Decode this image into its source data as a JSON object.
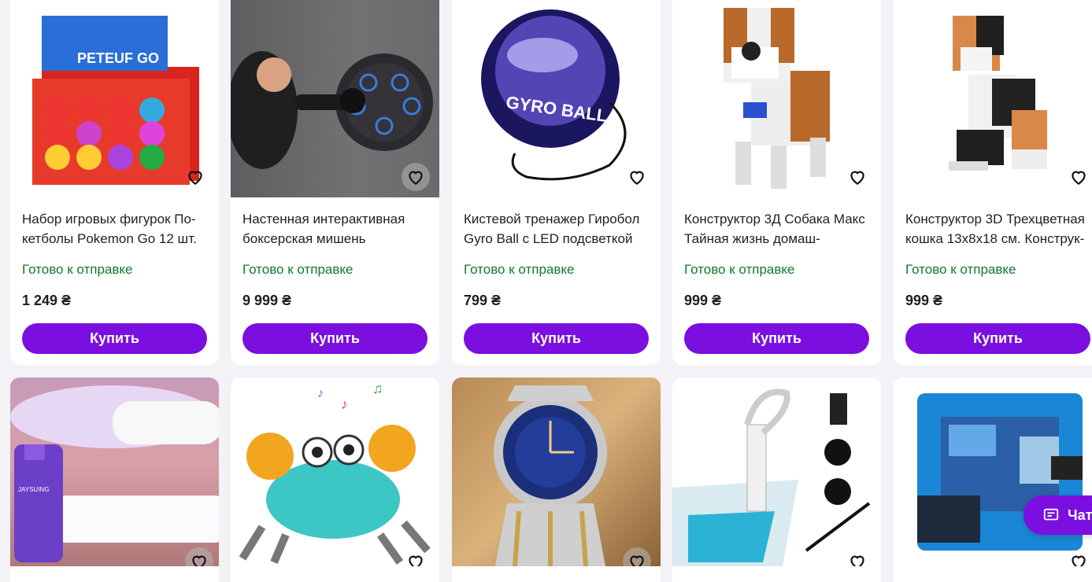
{
  "products_row1": [
    {
      "title": "Набор игровых фигурок По­кетболы Pokemon Go 12 шт.",
      "status": "Готово к отправке",
      "price": "1 249 ₴",
      "buy": "Купить"
    },
    {
      "title": "Настенная интерактивная боксерская мишень",
      "status": "Готово к отправке",
      "price": "9 999 ₴",
      "buy": "Купить"
    },
    {
      "title": "Кистевой тренажер Гиробол Gyro Ball с LED подсветкой",
      "status": "Готово к отправке",
      "price": "799 ₴",
      "buy": "Купить"
    },
    {
      "title": "Конструктор 3Д Собака Макс Тайная жизнь домаш-",
      "status": "Готово к отправке",
      "price": "999 ₴",
      "buy": "Купить"
    },
    {
      "title": "Конструктор 3D Трехцветная кошка 13x8x18 см. Конструк-",
      "status": "Готово к отправке",
      "price": "999 ₴",
      "buy": "Купить"
    }
  ],
  "image_text": {
    "gyro": "GYRO BALL",
    "pokeball_box": "PETEUF GO",
    "foam": "JAYSUING"
  },
  "chat": {
    "label": "Чат"
  },
  "colors": {
    "accent": "#7a0fe0",
    "status": "#117a2a"
  }
}
